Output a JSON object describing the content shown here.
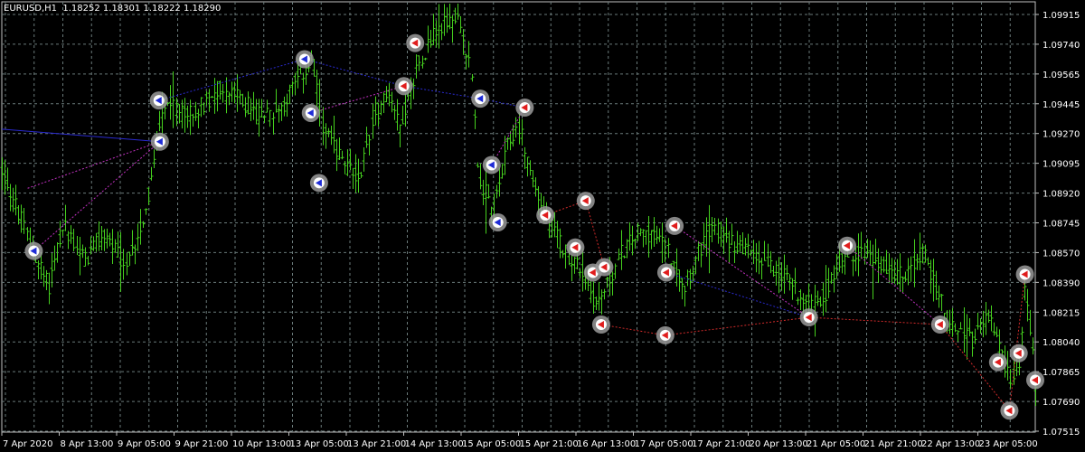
{
  "header": {
    "symbol": "EURUSD,H1",
    "ohlc": "1.18252 1.18301 1.18222 1.18290"
  },
  "colors": {
    "background": "#000000",
    "grid": "#6a7a7a",
    "axis_text": "#ffffff",
    "bar": "#45d01e",
    "marker_ring": "#9a9a9a",
    "marker_center": "#ffffff",
    "arrow_up": "#1e2bd6",
    "arrow_down": "#e01d1d",
    "line_blue": "#2a2ad0",
    "line_red": "#d02a2a",
    "line_magenta": "#c030c0"
  },
  "chart_data": {
    "type": "bar",
    "style": "ohlc-bars",
    "ylim": [
      1.0759,
      1.0999
    ],
    "grid": true,
    "y_ticks": [
      "1.09915",
      "1.09740",
      "1.09565",
      "1.09445",
      "1.09270",
      "1.09095",
      "1.08920",
      "1.08745",
      "1.08570",
      "1.08390",
      "1.08215",
      "1.08040",
      "1.07865",
      "1.07690",
      "1.07515"
    ],
    "x_ticks": [
      "7 Apr 2020",
      "8 Apr 13:00",
      "9 Apr 05:00",
      "9 Apr 21:00",
      "10 Apr 13:00",
      "13 Apr 05:00",
      "13 Apr 21:00",
      "14 Apr 13:00",
      "15 Apr 05:00",
      "15 Apr 21:00",
      "16 Apr 13:00",
      "17 Apr 05:00",
      "17 Apr 21:00",
      "20 Apr 13:00",
      "21 Apr 05:00",
      "21 Apr 21:00",
      "22 Apr 13:00",
      "23 Apr 05:00"
    ],
    "price_path": [
      [
        0,
        1.0905
      ],
      [
        0.01,
        1.089
      ],
      [
        0.03,
        1.086
      ],
      [
        0.045,
        1.084
      ],
      [
        0.06,
        1.0875
      ],
      [
        0.08,
        1.0855
      ],
      [
        0.1,
        1.087
      ],
      [
        0.12,
        1.085
      ],
      [
        0.14,
        1.0885
      ],
      [
        0.15,
        1.092
      ],
      [
        0.16,
        1.0945
      ],
      [
        0.175,
        1.0935
      ],
      [
        0.19,
        1.094
      ],
      [
        0.21,
        1.095
      ],
      [
        0.23,
        1.0945
      ],
      [
        0.25,
        1.0935
      ],
      [
        0.27,
        1.094
      ],
      [
        0.285,
        1.0955
      ],
      [
        0.3,
        1.0965
      ],
      [
        0.31,
        1.093
      ],
      [
        0.33,
        1.091
      ],
      [
        0.345,
        1.09
      ],
      [
        0.36,
        1.0935
      ],
      [
        0.375,
        1.095
      ],
      [
        0.385,
        1.093
      ],
      [
        0.4,
        1.096
      ],
      [
        0.415,
        1.098
      ],
      [
        0.43,
        1.0988
      ],
      [
        0.44,
        1.099
      ],
      [
        0.455,
        1.096
      ],
      [
        0.46,
        1.0905
      ],
      [
        0.475,
        1.088
      ],
      [
        0.49,
        1.092
      ],
      [
        0.5,
        1.093
      ],
      [
        0.515,
        1.0895
      ],
      [
        0.53,
        1.0875
      ],
      [
        0.545,
        1.086
      ],
      [
        0.56,
        1.085
      ],
      [
        0.575,
        1.083
      ],
      [
        0.585,
        1.084
      ],
      [
        0.6,
        1.086
      ],
      [
        0.615,
        1.087
      ],
      [
        0.63,
        1.087
      ],
      [
        0.645,
        1.086
      ],
      [
        0.66,
        1.084
      ],
      [
        0.675,
        1.086
      ],
      [
        0.69,
        1.0875
      ],
      [
        0.705,
        1.0865
      ],
      [
        0.72,
        1.086
      ],
      [
        0.735,
        1.0855
      ],
      [
        0.75,
        1.085
      ],
      [
        0.76,
        1.0845
      ],
      [
        0.78,
        1.083
      ],
      [
        0.795,
        1.0835
      ],
      [
        0.81,
        1.0855
      ],
      [
        0.83,
        1.086
      ],
      [
        0.845,
        1.0855
      ],
      [
        0.86,
        1.085
      ],
      [
        0.875,
        1.0845
      ],
      [
        0.89,
        1.086
      ],
      [
        0.905,
        1.084
      ],
      [
        0.915,
        1.082
      ],
      [
        0.93,
        1.0815
      ],
      [
        0.94,
        1.081
      ],
      [
        0.955,
        1.0825
      ],
      [
        0.965,
        1.0805
      ],
      [
        0.975,
        1.079
      ],
      [
        0.985,
        1.08
      ],
      [
        0.99,
        1.0845
      ],
      [
        1.0,
        1.0785
      ]
    ],
    "markers": [
      {
        "x": 0.031,
        "y": 1.086,
        "dir": "up"
      },
      {
        "x": 0.152,
        "y": 1.0944,
        "dir": "up"
      },
      {
        "x": 0.153,
        "y": 1.0921,
        "dir": "up"
      },
      {
        "x": 0.293,
        "y": 1.0967,
        "dir": "up"
      },
      {
        "x": 0.299,
        "y": 1.0937,
        "dir": "up"
      },
      {
        "x": 0.307,
        "y": 1.0898,
        "dir": "up"
      },
      {
        "x": 0.389,
        "y": 1.0952,
        "dir": "down"
      },
      {
        "x": 0.4,
        "y": 1.0976,
        "dir": "down"
      },
      {
        "x": 0.463,
        "y": 1.0945,
        "dir": "up"
      },
      {
        "x": 0.474,
        "y": 1.0908,
        "dir": "up"
      },
      {
        "x": 0.48,
        "y": 1.0876,
        "dir": "up"
      },
      {
        "x": 0.506,
        "y": 1.094,
        "dir": "down"
      },
      {
        "x": 0.526,
        "y": 1.088,
        "dir": "down"
      },
      {
        "x": 0.555,
        "y": 1.0862,
        "dir": "down"
      },
      {
        "x": 0.565,
        "y": 1.0888,
        "dir": "down"
      },
      {
        "x": 0.572,
        "y": 1.0848,
        "dir": "down"
      },
      {
        "x": 0.583,
        "y": 1.0851,
        "dir": "down"
      },
      {
        "x": 0.58,
        "y": 1.0819,
        "dir": "down"
      },
      {
        "x": 0.643,
        "y": 1.0848,
        "dir": "down"
      },
      {
        "x": 0.651,
        "y": 1.0874,
        "dir": "down"
      },
      {
        "x": 0.642,
        "y": 1.0813,
        "dir": "down"
      },
      {
        "x": 0.781,
        "y": 1.0823,
        "dir": "down"
      },
      {
        "x": 0.818,
        "y": 1.0863,
        "dir": "down"
      },
      {
        "x": 0.908,
        "y": 1.0819,
        "dir": "down"
      },
      {
        "x": 0.964,
        "y": 1.0798,
        "dir": "down"
      },
      {
        "x": 0.975,
        "y": 1.0771,
        "dir": "down"
      },
      {
        "x": 0.984,
        "y": 1.0803,
        "dir": "down"
      },
      {
        "x": 0.99,
        "y": 1.0847,
        "dir": "down"
      },
      {
        "x": 1.0,
        "y": 1.0788,
        "dir": "down"
      }
    ],
    "lines": [
      {
        "color": "line_blue",
        "dashed": false,
        "points": [
          [
            0,
            1.0928
          ],
          [
            0.153,
            1.0921
          ]
        ]
      },
      {
        "color": "line_magenta",
        "dashed": true,
        "points": [
          [
            0.031,
            1.086
          ],
          [
            0.153,
            1.0921
          ]
        ]
      },
      {
        "color": "line_magenta",
        "dashed": true,
        "points": [
          [
            0.025,
            1.0895
          ],
          [
            0.153,
            1.0921
          ]
        ]
      },
      {
        "color": "line_blue",
        "dashed": true,
        "points": [
          [
            0.152,
            1.0944
          ],
          [
            0.293,
            1.0967
          ],
          [
            0.389,
            1.0952
          ],
          [
            0.463,
            1.0945
          ],
          [
            0.506,
            1.094
          ]
        ]
      },
      {
        "color": "line_magenta",
        "dashed": true,
        "points": [
          [
            0.299,
            1.0937
          ],
          [
            0.389,
            1.0952
          ]
        ]
      },
      {
        "color": "line_magenta",
        "dashed": true,
        "points": [
          [
            0.474,
            1.0908
          ],
          [
            0.506,
            1.094
          ]
        ]
      },
      {
        "color": "line_red",
        "dashed": true,
        "points": [
          [
            0.526,
            1.088
          ],
          [
            0.565,
            1.0888
          ],
          [
            0.583,
            1.0851
          ]
        ]
      },
      {
        "color": "line_red",
        "dashed": true,
        "points": [
          [
            0.58,
            1.0819
          ],
          [
            0.642,
            1.0813
          ],
          [
            0.781,
            1.0823
          ],
          [
            0.908,
            1.0819
          ],
          [
            0.975,
            1.0771
          ]
        ]
      },
      {
        "color": "line_blue",
        "dashed": true,
        "points": [
          [
            0.643,
            1.0848
          ],
          [
            0.781,
            1.0823
          ]
        ]
      },
      {
        "color": "line_magenta",
        "dashed": true,
        "points": [
          [
            0.651,
            1.0874
          ],
          [
            0.781,
            1.0823
          ]
        ]
      },
      {
        "color": "line_magenta",
        "dashed": true,
        "points": [
          [
            0.818,
            1.0863
          ],
          [
            0.908,
            1.0819
          ]
        ]
      },
      {
        "color": "line_red",
        "dashed": true,
        "points": [
          [
            0.975,
            1.0771
          ],
          [
            0.99,
            1.0847
          ]
        ]
      }
    ]
  }
}
